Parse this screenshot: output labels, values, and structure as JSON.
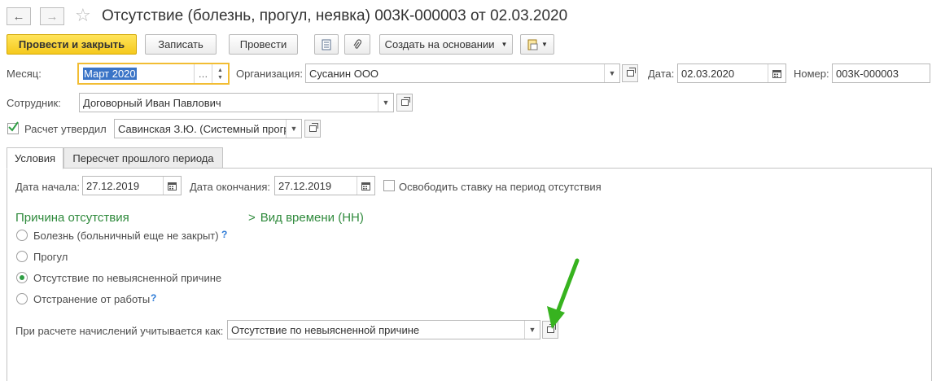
{
  "nav": {
    "back": "←",
    "forward": "→"
  },
  "title": "Отсутствие (болезнь, прогул, неявка) 003К-000003 от 02.03.2020",
  "toolbar": {
    "post_close": "Провести и закрыть",
    "save": "Записать",
    "post": "Провести",
    "create_based": "Создать на основании"
  },
  "fields": {
    "month_label": "Месяц:",
    "month_value": "Март 2020",
    "org_label": "Организация:",
    "org_value": "Сусанин ООО",
    "date_label": "Дата:",
    "date_value": "02.03.2020",
    "number_label": "Номер:",
    "number_value": "003К-000003",
    "employee_label": "Сотрудник:",
    "employee_value": "Договорный Иван Павлович",
    "approved_label": "Расчет утвердил",
    "approved_value": "Савинская З.Ю. (Системный прогр"
  },
  "tabs": [
    "Условия",
    "Пересчет прошлого периода"
  ],
  "conditions": {
    "start_label": "Дата начала:",
    "start_value": "27.12.2019",
    "end_label": "Дата окончания:",
    "end_value": "27.12.2019",
    "release_label": "Освободить ставку на период отсутствия",
    "reason_header": "Причина отсутствия",
    "time_kind_header": "Вид времени (НН)",
    "reasons": [
      "Болезнь (больничный еще не закрыт)",
      "Прогул",
      "Отсутствие по невыясненной причине",
      "Отстранение от работы"
    ],
    "help": "?",
    "accrual_label": "При расчете начислений учитывается как:",
    "accrual_value": "Отсутствие по невыясненной причине"
  },
  "colors": {
    "accent_green": "#2f8a3c",
    "primary_yellow": "#f5c91d",
    "arrow_green": "#37b31f"
  }
}
